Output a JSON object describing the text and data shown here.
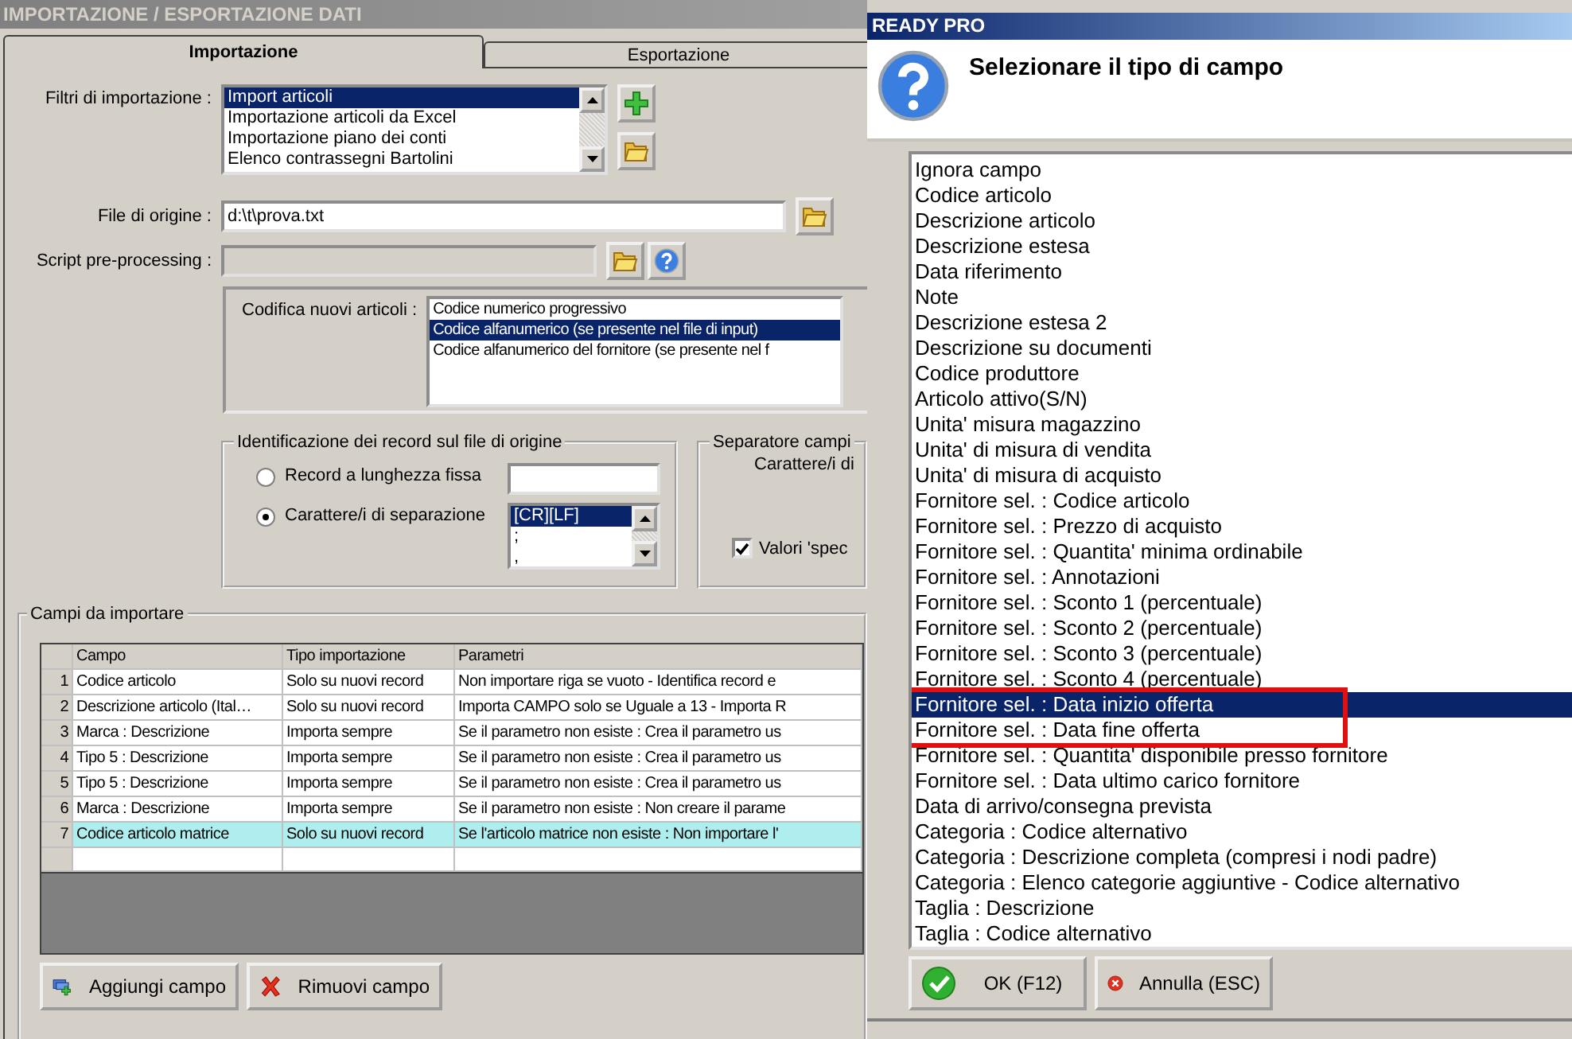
{
  "main_window": {
    "title": "IMPORTAZIONE / ESPORTAZIONE DATI",
    "tabs": [
      {
        "label": "Importazione",
        "selected": true
      },
      {
        "label": "Esportazione",
        "selected": false
      }
    ],
    "filters": {
      "label": "Filtri di importazione :",
      "items": [
        {
          "label": "Import articoli",
          "selected": true
        },
        {
          "label": "Importazione articoli da Excel",
          "selected": false
        },
        {
          "label": "Importazione piano dei conti",
          "selected": false
        },
        {
          "label": "Elenco contrassegni Bartolini",
          "selected": false
        }
      ]
    },
    "source_file": {
      "label": "File di origine :",
      "value": "d:\\t\\prova.txt"
    },
    "script": {
      "label": "Script pre-processing :"
    },
    "coding": {
      "label": "Codifica nuovi articoli :",
      "items": [
        {
          "label": "Codice numerico progressivo",
          "selected": false
        },
        {
          "label": "Codice alfanumerico (se presente nel file di input)",
          "selected": true
        },
        {
          "label": "Codice alfanumerico del fornitore (se presente nel f",
          "selected": false
        }
      ]
    },
    "record_id": {
      "title": "Identificazione dei record sul file di origine",
      "options": [
        {
          "label": "Record a lunghezza fissa",
          "selected": false
        },
        {
          "label": "Carattere/i di separazione",
          "selected": true
        }
      ],
      "separators": [
        {
          "label": "[CR][LF]",
          "selected": true
        },
        {
          "label": ";",
          "selected": false
        },
        {
          "label": ",",
          "selected": false
        }
      ]
    },
    "field_separator": {
      "title": "Separatore campi",
      "text": "Carattere/i di",
      "checkbox": {
        "label": "Valori 'spec",
        "checked": true
      }
    },
    "fields": {
      "title": "Campi da importare",
      "columns": [
        "Campo",
        "Tipo importazione",
        "Parametri"
      ],
      "rows": [
        {
          "num": "1",
          "cells": [
            "Codice articolo",
            "Solo su nuovi record",
            "Non importare riga se vuoto - Identifica record e"
          ],
          "selected": false
        },
        {
          "num": "2",
          "cells": [
            "Descrizione articolo (Ital…",
            "Solo su nuovi record",
            "Importa CAMPO solo se Uguale a 13 - Importa R"
          ],
          "selected": false
        },
        {
          "num": "3",
          "cells": [
            "Marca : Descrizione",
            "Importa sempre",
            "Se il parametro non esiste : Crea il parametro us"
          ],
          "selected": false
        },
        {
          "num": "4",
          "cells": [
            "Tipo 5 : Descrizione",
            "Importa sempre",
            "Se il parametro non esiste : Crea il parametro us"
          ],
          "selected": false
        },
        {
          "num": "5",
          "cells": [
            "Tipo 5 : Descrizione",
            "Importa sempre",
            "Se il parametro non esiste : Crea il parametro us"
          ],
          "selected": false
        },
        {
          "num": "6",
          "cells": [
            "Marca : Descrizione",
            "Importa sempre",
            "Se il parametro non esiste : Non creare il parame"
          ],
          "selected": false
        },
        {
          "num": "7",
          "cells": [
            "Codice articolo matrice",
            "Solo su nuovi record",
            "Se l'articolo matrice non esiste : Non importare l'"
          ],
          "selected": true
        }
      ],
      "buttons": [
        {
          "kind": "add",
          "label": "Aggiungi campo"
        },
        {
          "kind": "remove",
          "label": "Rimuovi campo"
        }
      ]
    }
  },
  "dialog": {
    "title": "READY PRO",
    "heading": "Selezionare il tipo di campo",
    "items": [
      {
        "label": "Ignora campo",
        "selected": false
      },
      {
        "label": "Codice articolo",
        "selected": false
      },
      {
        "label": "Descrizione articolo",
        "selected": false
      },
      {
        "label": "Descrizione estesa",
        "selected": false
      },
      {
        "label": "Data riferimento",
        "selected": false
      },
      {
        "label": "Note",
        "selected": false
      },
      {
        "label": "Descrizione estesa 2",
        "selected": false
      },
      {
        "label": "Descrizione su documenti",
        "selected": false
      },
      {
        "label": "Codice produttore",
        "selected": false
      },
      {
        "label": "Articolo attivo(S/N)",
        "selected": false
      },
      {
        "label": "Unita' misura magazzino",
        "selected": false
      },
      {
        "label": "Unita' di misura di vendita",
        "selected": false
      },
      {
        "label": "Unita' di misura di acquisto",
        "selected": false
      },
      {
        "label": "Fornitore sel. : Codice articolo",
        "selected": false
      },
      {
        "label": "Fornitore sel. : Prezzo di acquisto",
        "selected": false
      },
      {
        "label": "Fornitore sel. : Quantita' minima ordinabile",
        "selected": false
      },
      {
        "label": "Fornitore sel. : Annotazioni",
        "selected": false
      },
      {
        "label": "Fornitore sel. : Sconto 1 (percentuale)",
        "selected": false
      },
      {
        "label": "Fornitore sel. : Sconto 2 (percentuale)",
        "selected": false
      },
      {
        "label": "Fornitore sel. : Sconto 3 (percentuale)",
        "selected": false
      },
      {
        "label": "Fornitore sel. : Sconto 4 (percentuale)",
        "selected": false
      },
      {
        "label": "Fornitore sel. : Data inizio offerta",
        "selected": true
      },
      {
        "label": "Fornitore sel. : Data fine offerta",
        "selected": false
      },
      {
        "label": "Fornitore sel. : Quantita' disponibile presso fornitore",
        "selected": false
      },
      {
        "label": "Fornitore sel. : Data ultimo carico fornitore",
        "selected": false
      },
      {
        "label": "Data di arrivo/consegna prevista",
        "selected": false
      },
      {
        "label": "Categoria : Codice alternativo",
        "selected": false
      },
      {
        "label": "Categoria : Descrizione completa (compresi i nodi padre)",
        "selected": false
      },
      {
        "label": "Categoria : Elenco categorie aggiuntive - Codice alternativo",
        "selected": false
      },
      {
        "label": "Taglia : Descrizione",
        "selected": false
      },
      {
        "label": "Taglia : Codice alternativo",
        "selected": false
      }
    ],
    "buttons": [
      {
        "kind": "ok",
        "label": "OK (F12)"
      },
      {
        "kind": "cancel",
        "label": "Annulla (ESC)"
      }
    ]
  }
}
